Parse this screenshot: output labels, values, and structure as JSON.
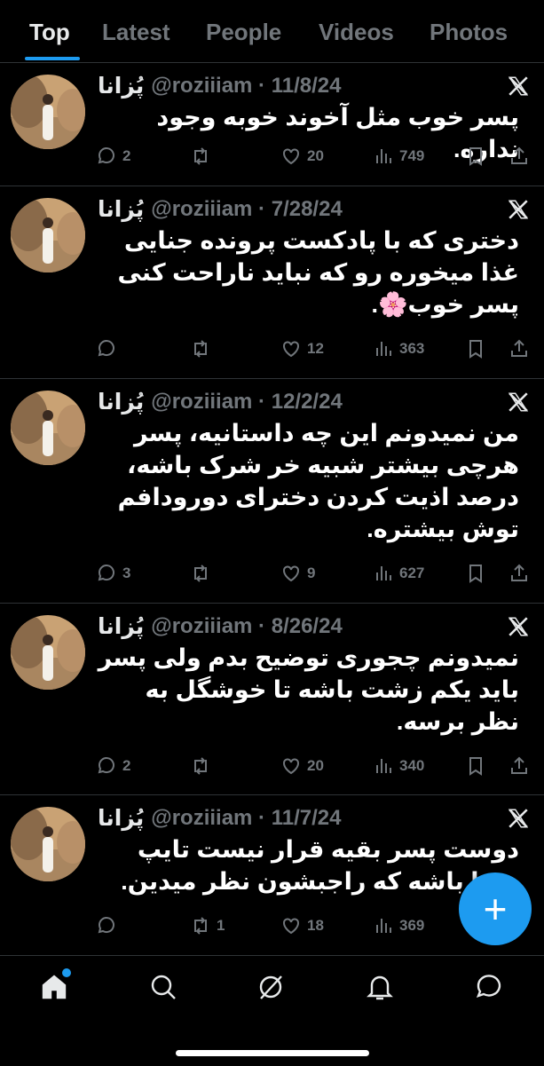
{
  "tabs": [
    "Top",
    "Latest",
    "People",
    "Videos",
    "Photos"
  ],
  "active_tab": "Top",
  "tweets": [
    {
      "name": "پُزانا",
      "handle": "@roziiiam",
      "date": "11/8/24",
      "text": "پسر خوب مثل آخوند خوبه وجود نداره.",
      "replies": "2",
      "reposts": "",
      "likes": "20",
      "views": "749"
    },
    {
      "name": "پُزانا",
      "handle": "@roziiiam",
      "date": "7/28/24",
      "text": "دختری که با پادکست پرونده جنایی غذا میخوره رو که نباید ناراحت کنی پسر خوب🌸.",
      "replies": "",
      "reposts": "",
      "likes": "12",
      "views": "363"
    },
    {
      "name": "پُزانا",
      "handle": "@roziiiam",
      "date": "12/2/24",
      "text": "من نمیدونم این چه داستانیه، پسر هرچی بیشتر شبیه خر شرک باشه، درصد اذیت کردن دخترای دورودافم توش بیشتره.",
      "replies": "3",
      "reposts": "",
      "likes": "9",
      "views": "627"
    },
    {
      "name": "پُزانا",
      "handle": "@roziiiam",
      "date": "8/26/24",
      "text": "نمیدونم چجوری توضیح بدم ولی پسر باید یکم زشت باشه تا خوشگل به نظر برسه.",
      "replies": "2",
      "reposts": "",
      "likes": "20",
      "views": "340"
    },
    {
      "name": "پُزانا",
      "handle": "@roziiiam",
      "date": "11/7/24",
      "text": "دوست پسر بقیه قرار نیست تایپ شما باشه که راجبشون نظر میدین.",
      "replies": "",
      "reposts": "1",
      "likes": "18",
      "views": "369"
    }
  ],
  "fab_label": "+",
  "bottom_nav": [
    "home-icon",
    "search-icon",
    "grok-icon",
    "notifications-icon",
    "messages-icon"
  ],
  "colors": {
    "accent": "#1d9bf0",
    "background": "#000000",
    "muted": "#71767b",
    "text": "#e7e9ea"
  }
}
